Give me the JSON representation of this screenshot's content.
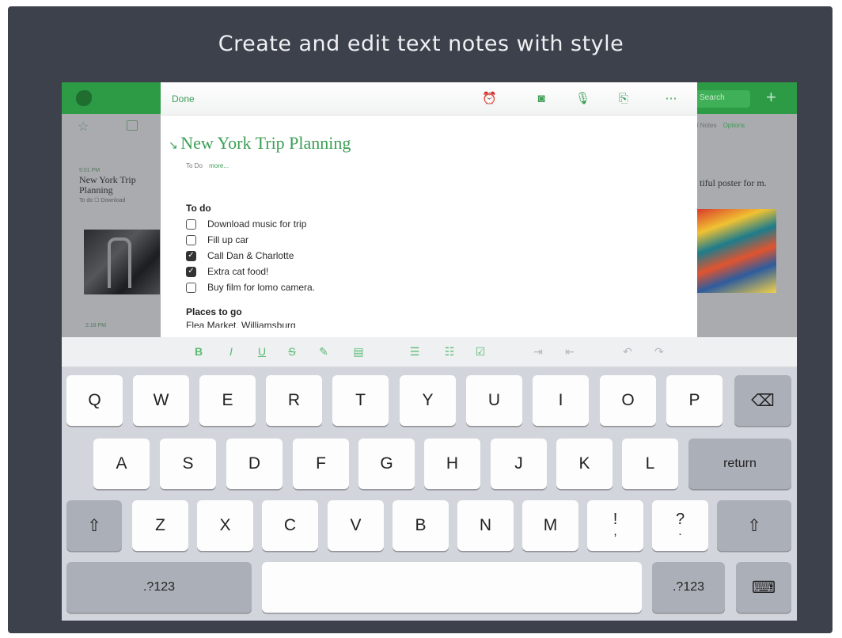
{
  "headline": "Create and edit text notes with style",
  "background_app": {
    "left_note": {
      "date": "5:01 PM",
      "title": "New York Trip Planning",
      "snippet": "To do ☐ Download"
    },
    "right_header": {
      "count": "8 Notes",
      "options": "Options"
    },
    "right_note_title": "tiful poster for m.",
    "search_label": "Search",
    "bottom_date": "2:18 PM"
  },
  "editor": {
    "done_label": "Done",
    "toolbar_icons": [
      "reminder-icon",
      "camera-icon",
      "microphone-icon",
      "attachment-icon",
      "more-icon"
    ],
    "note_title": "New York Trip Planning",
    "notebook": "To Do",
    "more_label": "more...",
    "todo_heading": "To do",
    "todos": [
      {
        "text": "Download music for trip",
        "checked": false
      },
      {
        "text": "Fill up car",
        "checked": false
      },
      {
        "text": "Call Dan & Charlotte",
        "checked": true
      },
      {
        "text": "Extra cat food!",
        "checked": true
      },
      {
        "text": "Buy film for lomo camera.",
        "checked": false
      }
    ],
    "places_heading": "Places to go",
    "places_text": "Flea Market, Williamsburg"
  },
  "format_bar": {
    "bold": "B",
    "italic": "I",
    "underline": "U",
    "strike": "S",
    "highlight_icon": "highlighter-icon",
    "align_icon": "align-icon",
    "bullet_icon": "bullet-list-icon",
    "numbered_icon": "numbered-list-icon",
    "checkbox_icon": "checkbox-icon",
    "indent_icon": "indent-icon",
    "outdent_icon": "outdent-icon",
    "undo_icon": "undo-icon",
    "redo_icon": "redo-icon"
  },
  "keyboard": {
    "row1": [
      "Q",
      "W",
      "E",
      "R",
      "T",
      "Y",
      "U",
      "I",
      "O",
      "P"
    ],
    "row2": [
      "A",
      "S",
      "D",
      "F",
      "G",
      "H",
      "J",
      "K",
      "L"
    ],
    "row3": [
      "Z",
      "X",
      "C",
      "V",
      "B",
      "N",
      "M"
    ],
    "punct1_top": "!",
    "punct1_bot": ",",
    "punct2_top": "?",
    "punct2_bot": ".",
    "return_label": "return",
    "numbers_label": ".?123",
    "backspace_glyph": "⌫",
    "shift_glyph": "⇧",
    "hide_glyph": "⌨"
  }
}
